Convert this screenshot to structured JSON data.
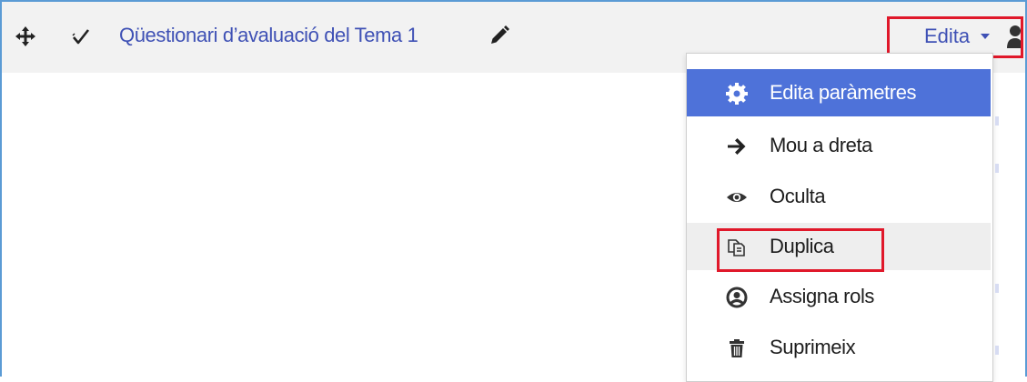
{
  "activity": {
    "title": "Qüestionari d’avaluació del Tema 1",
    "edit_label": "Edita"
  },
  "menu": {
    "items": [
      {
        "label": "Edita paràmetres",
        "icon": "gear-icon",
        "state": "active"
      },
      {
        "label": "Mou a dreta",
        "icon": "arrow-right-icon",
        "state": "normal"
      },
      {
        "label": "Oculta",
        "icon": "eye-icon",
        "state": "normal"
      },
      {
        "label": "Duplica",
        "icon": "duplicate-icon",
        "state": "hover"
      },
      {
        "label": "Assigna rols",
        "icon": "user-circle-icon",
        "state": "normal"
      },
      {
        "label": "Suprimeix",
        "icon": "trash-icon",
        "state": "normal"
      }
    ]
  },
  "colors": {
    "link": "#3f51b5",
    "active_item": "#4e72d9",
    "highlight_box": "#e0182a",
    "frame": "#5b9bd5"
  }
}
